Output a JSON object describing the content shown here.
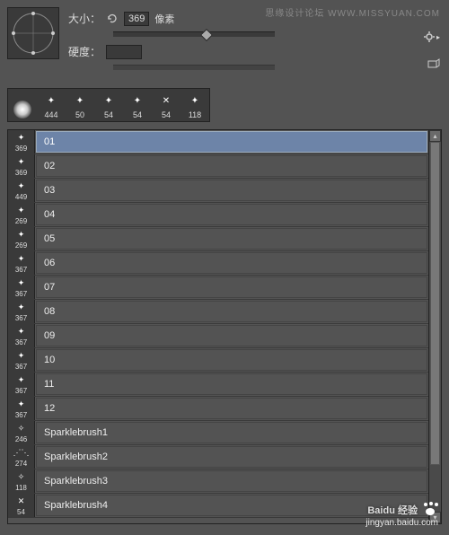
{
  "watermark_top": "思缘设计论坛  WWW.MISSYUAN.COM",
  "header": {
    "size_label": "大小：",
    "size_value": "369",
    "size_unit": "像素",
    "hardness_label": "硬度：",
    "slider_pos_pct": 55
  },
  "thumbs": [
    {
      "size": "",
      "type": "soft"
    },
    {
      "size": "444",
      "type": "star"
    },
    {
      "size": "50",
      "type": "star"
    },
    {
      "size": "54",
      "type": "star"
    },
    {
      "size": "54",
      "type": "star"
    },
    {
      "size": "54",
      "type": "cross"
    },
    {
      "size": "118",
      "type": "star"
    }
  ],
  "brushes": [
    {
      "thumb_size": "369",
      "name": "01",
      "selected": true,
      "icon": "star"
    },
    {
      "thumb_size": "369",
      "name": "02",
      "selected": false,
      "icon": "star"
    },
    {
      "thumb_size": "449",
      "name": "03",
      "selected": false,
      "icon": "star"
    },
    {
      "thumb_size": "269",
      "name": "04",
      "selected": false,
      "icon": "star"
    },
    {
      "thumb_size": "269",
      "name": "05",
      "selected": false,
      "icon": "star"
    },
    {
      "thumb_size": "367",
      "name": "06",
      "selected": false,
      "icon": "star"
    },
    {
      "thumb_size": "367",
      "name": "07",
      "selected": false,
      "icon": "star"
    },
    {
      "thumb_size": "367",
      "name": "08",
      "selected": false,
      "icon": "star"
    },
    {
      "thumb_size": "367",
      "name": "09",
      "selected": false,
      "icon": "star"
    },
    {
      "thumb_size": "367",
      "name": "10",
      "selected": false,
      "icon": "star"
    },
    {
      "thumb_size": "367",
      "name": "11",
      "selected": false,
      "icon": "star"
    },
    {
      "thumb_size": "367",
      "name": "12",
      "selected": false,
      "icon": "star"
    },
    {
      "thumb_size": "246",
      "name": "Sparklebrush1",
      "selected": false,
      "icon": "sparkle"
    },
    {
      "thumb_size": "274",
      "name": "Sparklebrush2",
      "selected": false,
      "icon": "sparkle"
    },
    {
      "thumb_size": "118",
      "name": "Sparklebrush3",
      "selected": false,
      "icon": "sparkle"
    },
    {
      "thumb_size": "54",
      "name": "Sparklebrush4",
      "selected": false,
      "icon": "cross"
    }
  ],
  "watermark_bottom": {
    "line1": "Baidu 经验",
    "line2": "jingyan.baidu.com"
  }
}
